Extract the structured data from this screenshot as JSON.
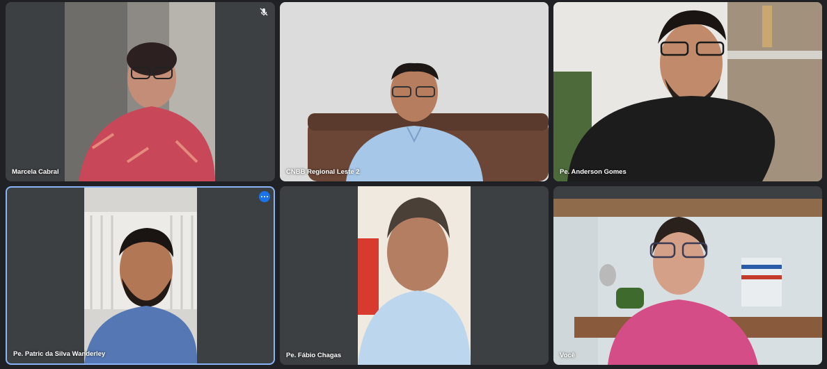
{
  "participants": [
    {
      "name": "Marcela Cabral",
      "muted": true
    },
    {
      "name": "CNBB Regional Leste 2"
    },
    {
      "name": "Pe. Anderson Gomes"
    },
    {
      "name": "Pe. Patric da Silva Wanderley",
      "active_speaker": true
    },
    {
      "name": "Pe. Fábio Chagas"
    },
    {
      "name": "Você"
    }
  ],
  "colors": {
    "background": "#202124",
    "tile": "#3c4043",
    "highlight_border": "#8ab4f8",
    "more_button": "#1a73e8"
  }
}
